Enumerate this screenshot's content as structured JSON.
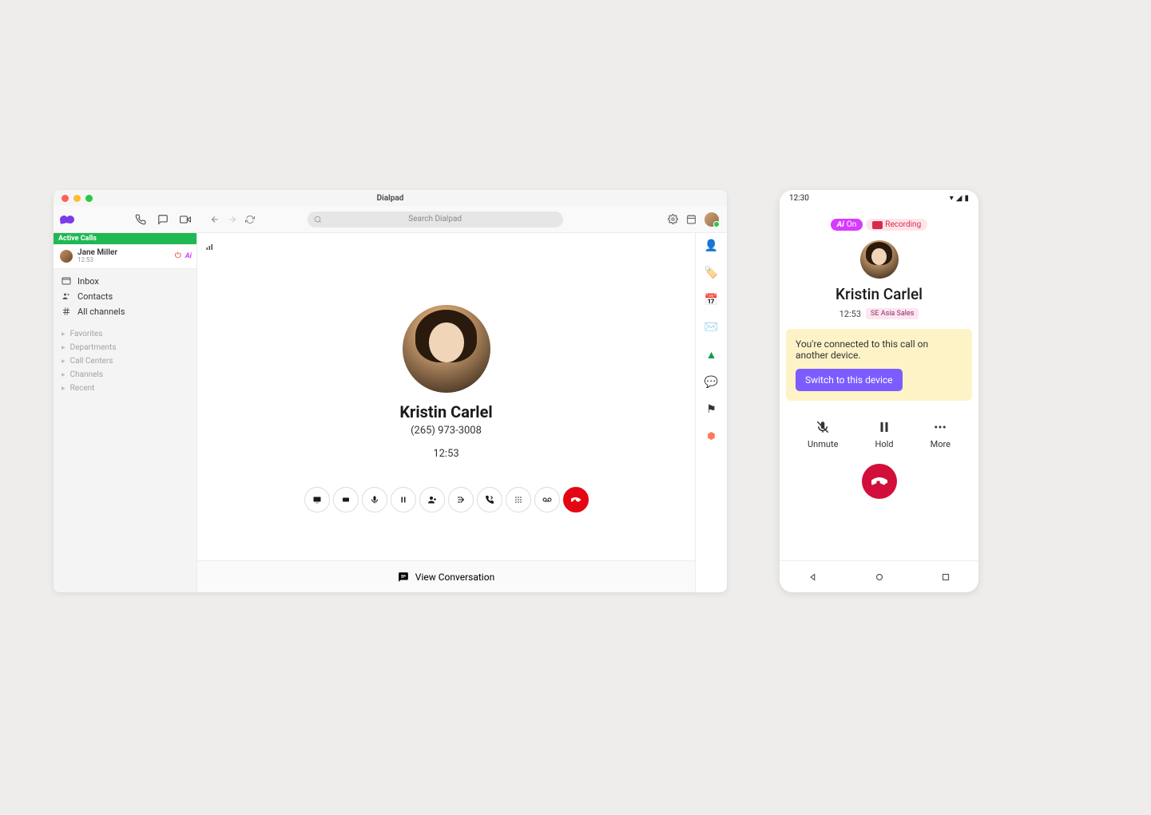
{
  "desktop": {
    "title": "Dialpad",
    "search_placeholder": "Search Dialpad",
    "sidebar": {
      "active_header": "Active Calls",
      "active_call": {
        "name": "Jane Miller",
        "time": "12:53"
      },
      "nav": [
        {
          "label": "Inbox"
        },
        {
          "label": "Contacts"
        },
        {
          "label": "All channels"
        }
      ],
      "sections": [
        {
          "label": "Favorites"
        },
        {
          "label": "Departments"
        },
        {
          "label": "Call Centers"
        },
        {
          "label": "Channels"
        },
        {
          "label": "Recent"
        }
      ]
    },
    "call": {
      "name": "Kristin Carlel",
      "phone": "(265) 973-3008",
      "time": "12:53"
    },
    "footer": {
      "label": "View Conversation"
    },
    "call_buttons": [
      "screen-share",
      "record",
      "mic",
      "pause",
      "add-person",
      "add-to-call",
      "transfer",
      "dialpad",
      "voicemail",
      "hangup"
    ],
    "rail": [
      "person",
      "tag",
      "calendar",
      "gmail",
      "drive",
      "chat",
      "zendesk",
      "hubspot"
    ]
  },
  "mobile": {
    "status_time": "12:30",
    "badge_ai": "On",
    "badge_rec": "Recording",
    "name": "Kristin Carlel",
    "time": "12:53",
    "tag": "SE Asia Sales",
    "notice_text": "You're connected to this call on another device.",
    "notice_button": "Switch to this device",
    "actions": {
      "unmute": "Unmute",
      "hold": "Hold",
      "more": "More"
    }
  }
}
